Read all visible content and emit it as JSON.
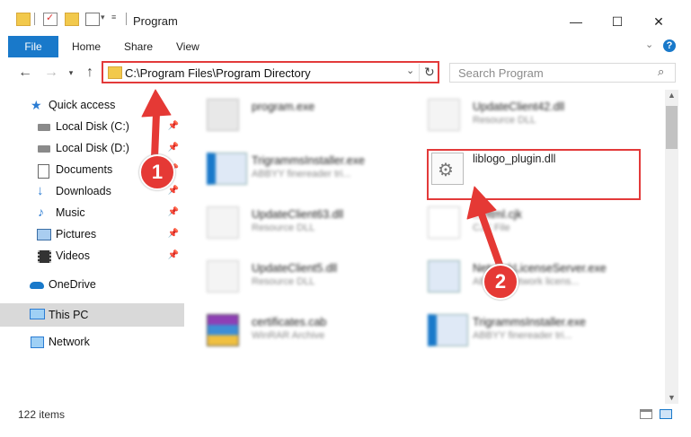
{
  "window": {
    "title": "Program",
    "minimize": "—",
    "maximize": "☐",
    "close": "✕"
  },
  "ribbon": {
    "tabs": [
      "File",
      "Home",
      "Share",
      "View"
    ]
  },
  "address": {
    "path": "C:\\Program Files\\Program Directory",
    "search_placeholder": "Search Program"
  },
  "nav_pane": {
    "quick_access": "Quick access",
    "items": [
      {
        "label": "Local Disk (C:)",
        "icon": "drive-icon"
      },
      {
        "label": "Local Disk (D:)",
        "icon": "drive-icon"
      },
      {
        "label": "Documents",
        "icon": "documents-icon"
      },
      {
        "label": "Downloads",
        "icon": "downloads-icon"
      },
      {
        "label": "Music",
        "icon": "music-icon"
      },
      {
        "label": "Pictures",
        "icon": "pictures-icon"
      },
      {
        "label": "Videos",
        "icon": "videos-icon"
      }
    ],
    "onedrive": "OneDrive",
    "this_pc": "This PC",
    "network": "Network"
  },
  "files": [
    {
      "name": "program.exe",
      "sub": ""
    },
    {
      "name": "UpdateClient42.dll",
      "sub": "Resource DLL"
    },
    {
      "name": "TrigrammsInstaller.exe",
      "sub": "ABBYY finereader tri..."
    },
    {
      "name": "liblogo_plugin.dll",
      "sub": ""
    },
    {
      "name": "UpdateClient63.dll",
      "sub": "Resource DLL"
    },
    {
      "name": "...Html.cjk",
      "sub": "CJK File"
    },
    {
      "name": "UpdateClient5.dll",
      "sub": "Resource DLL"
    },
    {
      "name": "NetworkLicenseServer.exe",
      "sub": "ABBYY network licens..."
    },
    {
      "name": "certificates.cab",
      "sub": "WinRAR Archive"
    },
    {
      "name": "TrigrammsInstaller.exe",
      "sub": "ABBYY finereader tri..."
    }
  ],
  "status": {
    "items_count": "122 items"
  },
  "callouts": [
    "1",
    "2"
  ],
  "colors": {
    "accent": "#1979ca",
    "highlight": "#e33a3a",
    "selection": "#d9d9d9"
  }
}
